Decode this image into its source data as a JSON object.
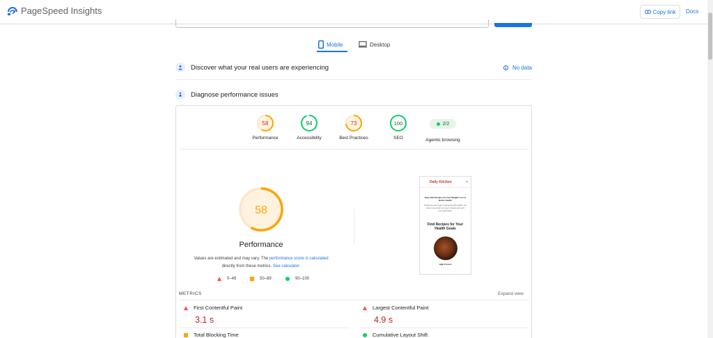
{
  "header": {
    "brand": "PageSpeed Insights",
    "copy_link": "Copy link",
    "docs": "Docs"
  },
  "tabs": [
    {
      "label": "Mobile",
      "icon": "smartphone-icon",
      "active": true
    },
    {
      "label": "Desktop",
      "icon": "monitor-icon",
      "active": false
    }
  ],
  "discover": {
    "title": "Discover what your real users are experiencing",
    "status": "No data"
  },
  "diagnose": {
    "title": "Diagnose performance issues"
  },
  "categories": [
    {
      "label": "Performance",
      "score": "58",
      "status": "average"
    },
    {
      "label": "Accessibility",
      "score": "94",
      "status": "pass"
    },
    {
      "label": "Best Practices",
      "score": "73",
      "status": "average"
    },
    {
      "label": "SEO",
      "score": "100",
      "status": "pass"
    },
    {
      "label": "Agentic browsing",
      "score": "2/2",
      "status": "pass"
    }
  ],
  "performance": {
    "score": "58",
    "title": "Performance",
    "note_prefix": "Values are estimated and may vary. The ",
    "note_link1": "performance score is calculated",
    "note_mid": " directly from these metrics. ",
    "note_link2": "See calculator."
  },
  "legend": [
    {
      "shape": "triangle",
      "range": "0–49",
      "color": "#ff4e42"
    },
    {
      "shape": "square",
      "range": "50–89",
      "color": "#ffa400"
    },
    {
      "shape": "circle",
      "range": "90–100",
      "color": "#0cce6b"
    }
  ],
  "screenshot": {
    "site_name": "Daily Kitchen",
    "close": "×",
    "headline": "Easy Diet Recipes for Fast Weight Loss & Better Health",
    "subtext": "Simple low-carb meals, beginner-friendly guides, and proven tips to help you stay in ketosis and reach your goals faster.",
    "section_title": "Find Recipes for Your Health Goals",
    "caption": "High Protein"
  },
  "metrics": {
    "label": "METRICS",
    "expand": "Expand view",
    "items": [
      {
        "name": "First Contentful Paint",
        "value": "3.1 s",
        "status": "fail"
      },
      {
        "name": "Largest Contentful Paint",
        "value": "4.9 s",
        "status": "fail"
      },
      {
        "name": "Total Blocking Time",
        "value": "",
        "status": "average"
      },
      {
        "name": "Cumulative Layout Shift",
        "value": "",
        "status": "pass"
      }
    ]
  },
  "colors": {
    "accent": "#1a73e8",
    "average": "#ffa400",
    "pass": "#0cce6b",
    "fail": "#ff4e42",
    "fail_text": "#c5221f"
  }
}
